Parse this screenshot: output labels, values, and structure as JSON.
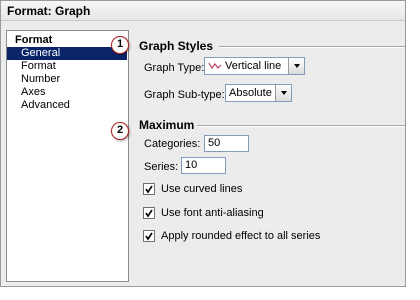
{
  "window": {
    "title": "Format: Graph"
  },
  "tree": {
    "root": "Format",
    "items": [
      "General",
      "Format",
      "Number",
      "Axes",
      "Advanced"
    ],
    "selected": "General"
  },
  "callouts": [
    "1",
    "2"
  ],
  "graph_styles": {
    "title": "Graph Styles",
    "graph_type_label": "Graph Type:",
    "graph_type_value": "Vertical line",
    "sub_type_label": "Graph Sub-type:",
    "sub_type_value": "Absolute"
  },
  "maximum": {
    "title": "Maximum",
    "categories_label": "Categories:",
    "categories_value": "50",
    "series_label": "Series:",
    "series_value": "10"
  },
  "options": [
    {
      "label": "Use curved lines",
      "checked": true
    },
    {
      "label": "Use font anti-aliasing",
      "checked": true
    },
    {
      "label": "Apply rounded effect to all series",
      "checked": true
    }
  ],
  "colors": {
    "selection": "#0a246a",
    "callout_border": "#b22020",
    "line_icon": "#c04060"
  }
}
